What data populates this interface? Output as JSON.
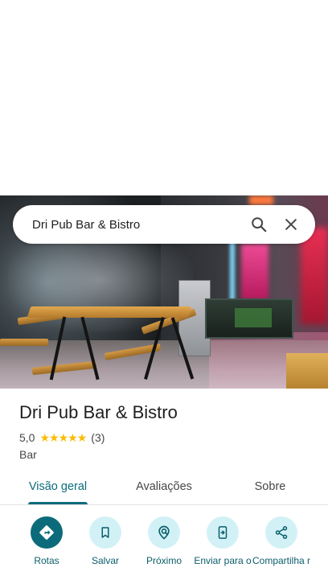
{
  "search": {
    "query": "Dri Pub Bar & Bistro",
    "search_icon": "search-icon",
    "close_icon": "close-icon"
  },
  "place": {
    "name": "Dri Pub Bar & Bistro",
    "rating": "5,0",
    "stars": 5,
    "review_count": "(3)",
    "category": "Bar"
  },
  "tabs": [
    {
      "label": "Visão geral",
      "active": true
    },
    {
      "label": "Avaliações",
      "active": false
    },
    {
      "label": "Sobre",
      "active": false
    }
  ],
  "actions": [
    {
      "label": "Rotas",
      "icon": "directions-icon"
    },
    {
      "label": "Salvar",
      "icon": "bookmark-icon"
    },
    {
      "label": "Próximo",
      "icon": "nearby-icon"
    },
    {
      "label": "Enviar para o",
      "icon": "send-to-phone-icon"
    },
    {
      "label": "Compartilha r",
      "icon": "share-icon"
    }
  ],
  "colors": {
    "accent": "#0b6b7a",
    "action_bg": "#d2f1f7",
    "star": "#fbbc04"
  }
}
